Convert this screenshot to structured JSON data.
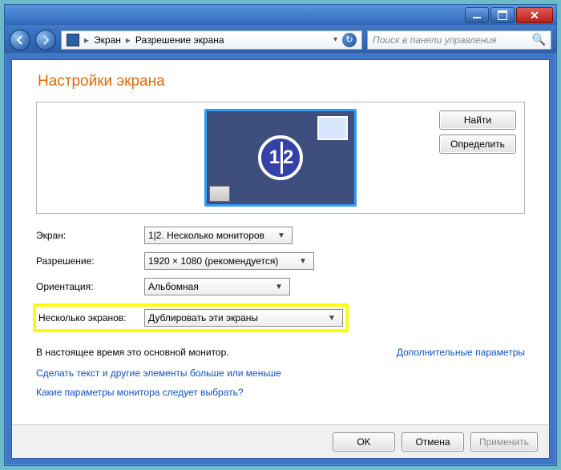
{
  "titlebar": {},
  "breadcrumbs": {
    "root": "Экран",
    "page": "Разрешение экрана"
  },
  "search": {
    "placeholder": "Поиск в панели управления"
  },
  "heading": "Настройки экрана",
  "preview": {
    "detect_label": "Найти",
    "identify_label": "Определить",
    "badge_left": "1",
    "badge_right": "2"
  },
  "form": {
    "display_label": "Экран:",
    "display_value": "1|2. Несколько мониторов",
    "resolution_label": "Разрешение:",
    "resolution_value": "1920 × 1080 (рекомендуется)",
    "orientation_label": "Ориентация:",
    "orientation_value": "Альбомная",
    "multi_label": "Несколько экранов:",
    "multi_value": "Дублировать эти экраны"
  },
  "note": "В настоящее время это основной монитор.",
  "adv_link": "Дополнительные параметры",
  "link_textsize": "Сделать текст и другие элементы больше или меньше",
  "link_help": "Какие параметры монитора следует выбрать?",
  "buttons": {
    "ok": "OK",
    "cancel": "Отмена",
    "apply": "Применить"
  }
}
